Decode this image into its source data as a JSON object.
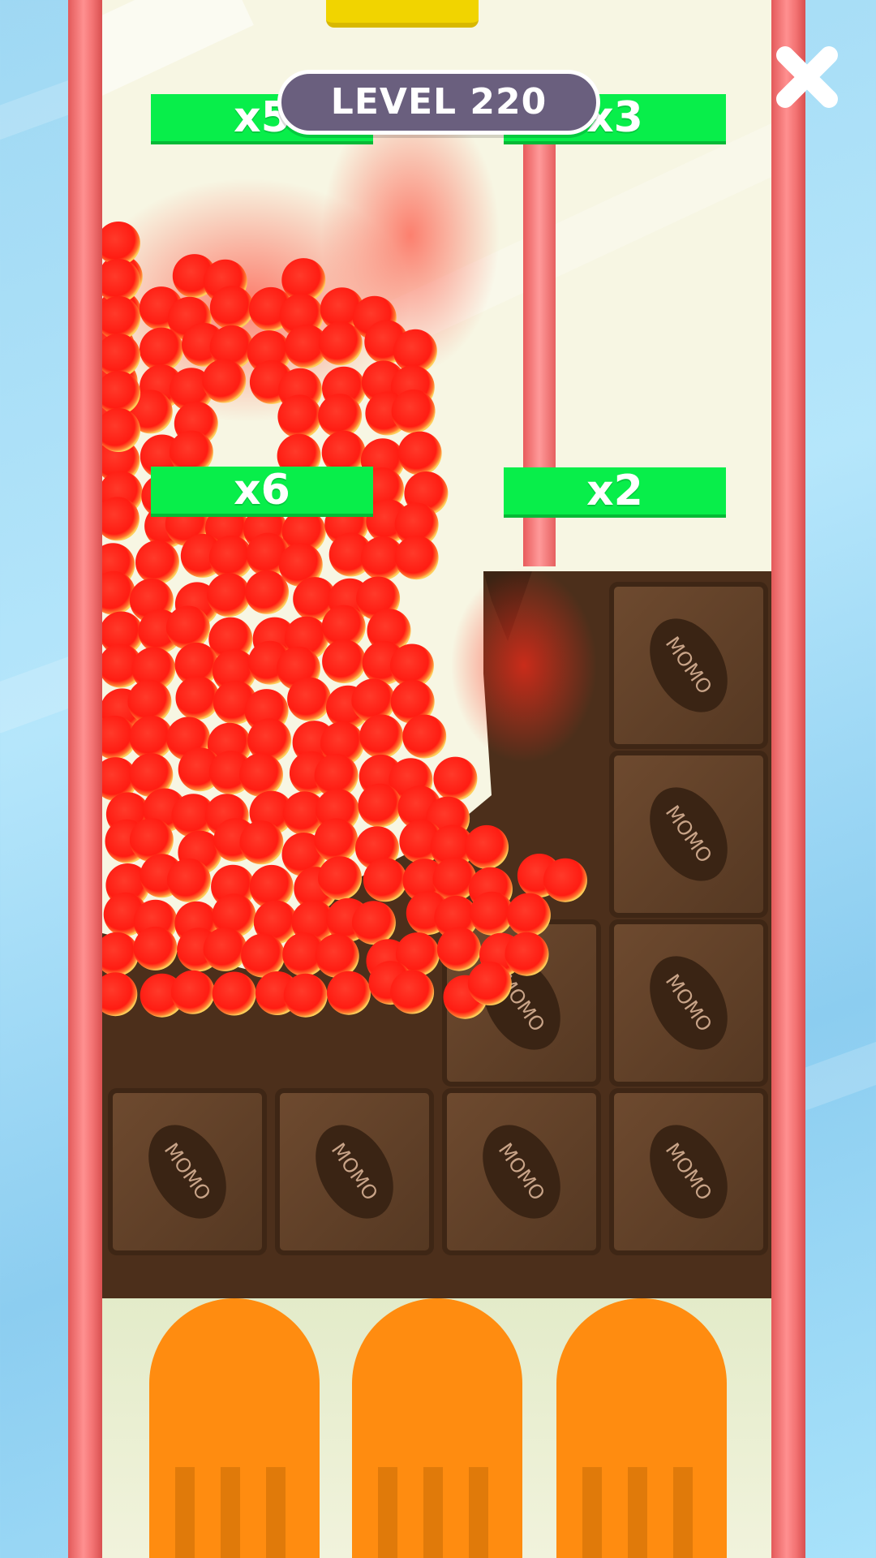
{
  "game": {
    "level_label": "LEVEL 220",
    "close_label": "✕",
    "multipliers": {
      "top_left": "x5",
      "top_right": "x3",
      "mid_left": "x6",
      "mid_right": "x2"
    },
    "chocolate_brand": "MOMO"
  },
  "colors": {
    "background_sky": "#a8e2fa",
    "playfield": "#f7f6e3",
    "rail": "#f47575",
    "multiplier_gate": "#08ee4a",
    "level_pill": "#6a5f7e",
    "chocolate": "#5a3a22",
    "balls": "#ff2a1a",
    "paddle": "#ff8c10"
  }
}
